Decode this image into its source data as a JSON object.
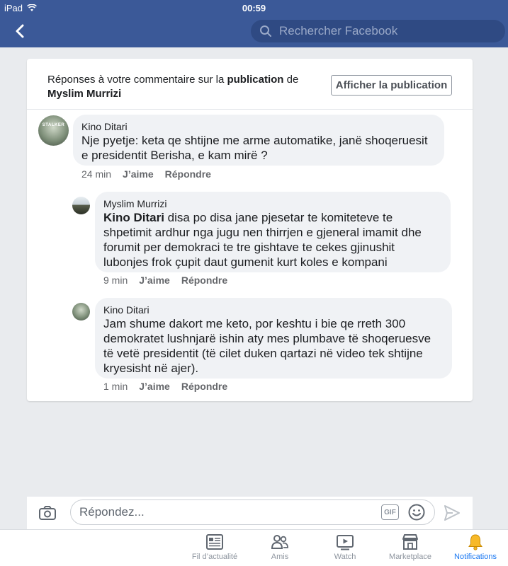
{
  "status_bar": {
    "device": "iPad",
    "time": "00:59"
  },
  "search": {
    "placeholder": "Rechercher Facebook"
  },
  "header": {
    "prefix": "Réponses à votre commentaire sur la ",
    "publication_word": "publication",
    "connector": " de",
    "author": "Myslim Murrizi",
    "view_post_button": "Afficher la publication"
  },
  "comments": [
    {
      "author": "Kino Ditari",
      "avatar_text": "STALKER",
      "text": "Nje pyetje: keta qe shtijne me arme automatike, janë shoqeruesit e presidentit Berisha, e kam mirë ?",
      "time": "24 min",
      "like": "J’aime",
      "reply": "Répondre"
    },
    {
      "author": "Myslim Murrizi",
      "mention": "Kino Ditari",
      "text": " disa po disa jane pjesetar te komiteteve te shpetimit ardhur nga jugu nen thirrjen e gjeneral imamit dhe forumit per demokraci te tre gishtave te cekes gjinushit lubonjes frok çupit daut gumenit kurt koles e kompani",
      "time": "9 min",
      "like": "J’aime",
      "reply": "Répondre"
    },
    {
      "author": "Kino Ditari",
      "text": "Jam shume dakort me keto, por keshtu i bie qe rreth 300 demokratet lushnjarë ishin aty mes plumbave të shoqeruesve të vetë presidentit (të cilet duken qartazi në video tek shtijne kryesisht në ajer).",
      "time": "1 min",
      "like": "J’aime",
      "reply": "Répondre"
    }
  ],
  "composer": {
    "placeholder": "Répondez...",
    "gif_label": "GIF"
  },
  "tabs": [
    {
      "label": "Fil d’actualité",
      "icon": "news-feed-icon"
    },
    {
      "label": "Amis",
      "icon": "friends-icon"
    },
    {
      "label": "Watch",
      "icon": "watch-icon"
    },
    {
      "label": "Marketplace",
      "icon": "marketplace-icon"
    },
    {
      "label": "Notifications",
      "icon": "notifications-bell-icon",
      "active": true
    }
  ],
  "colors": {
    "brand": "#3b5998",
    "active_tab": "#1877f2",
    "bell": "#f7b928"
  }
}
